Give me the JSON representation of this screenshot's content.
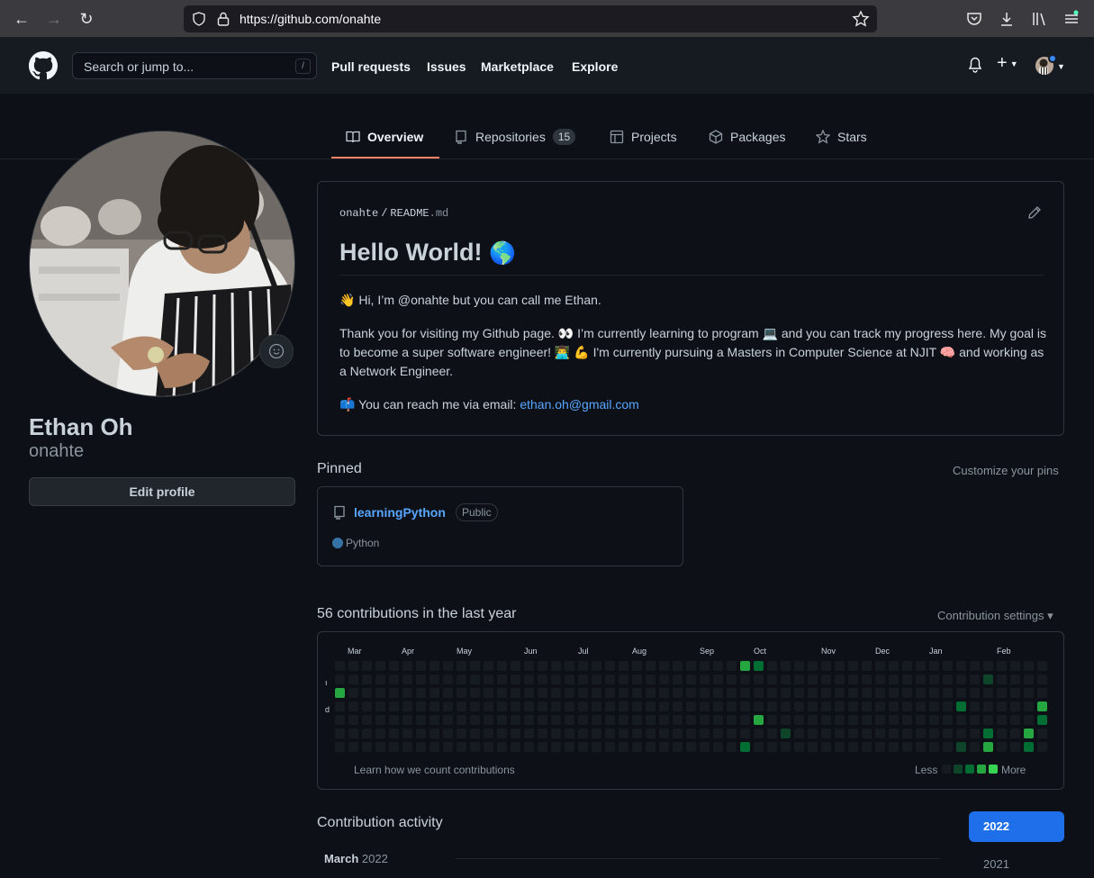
{
  "browser": {
    "url": "https://github.com/onahte"
  },
  "header": {
    "search_placeholder": "Search or jump to...",
    "search_key": "/",
    "nav": [
      "Pull requests",
      "Issues",
      "Marketplace",
      "Explore"
    ],
    "plus_label": "+"
  },
  "tabs": [
    {
      "label": "Overview",
      "icon": "book-icon",
      "active": true
    },
    {
      "label": "Repositories",
      "icon": "repo-icon",
      "count": "15"
    },
    {
      "label": "Projects",
      "icon": "table-icon"
    },
    {
      "label": "Packages",
      "icon": "package-icon"
    },
    {
      "label": "Stars",
      "icon": "star-icon"
    }
  ],
  "profile": {
    "full_name": "Ethan Oh",
    "username": "onahte",
    "edit_label": "Edit profile"
  },
  "readme": {
    "owner": "onahte",
    "sep": "/",
    "file": "README",
    "ext": ".md",
    "title": "Hello World!",
    "title_emoji": "🌎",
    "line1": "Hi, I’m @onahte but you can call me Ethan.",
    "line1_emoji": "👋",
    "para2_a": "Thank you for visiting my Github page. ",
    "para2_b": " I’m currently learning to program ",
    "para2_c": " and you can track my progress here. My goal is to become a super software engineer! ",
    "para2_d": " I'm currently pursuing a Masters in Computer Science at NJIT ",
    "para2_e": " and working as a Network Engineer.",
    "emoji_eyes": "👀",
    "emoji_laptop": "💻",
    "emoji_tech": "👨‍💻",
    "emoji_muscle": "💪",
    "emoji_brain": "🧠",
    "contact_emoji": "📫",
    "contact_text": "You can reach me via email: ",
    "email": "ethan.oh@gmail.com"
  },
  "pinned": {
    "title": "Pinned",
    "customize": "Customize your pins",
    "repo_name": "learningPython",
    "visibility": "Public",
    "language": "Python",
    "language_color": "#3572a5"
  },
  "contributions": {
    "title": "56 contributions in the last year",
    "settings": "Contribution settings ▾",
    "months": [
      "Mar",
      "Apr",
      "May",
      "Jun",
      "Jul",
      "Aug",
      "Sep",
      "Oct",
      "Nov",
      "Dec",
      "Jan",
      "Feb"
    ],
    "day_labels": [
      "ı",
      "d"
    ],
    "learn": "Learn how we count contributions",
    "less": "Less",
    "more": "More",
    "legend_colors": [
      "#161b22",
      "#0e4429",
      "#006d32",
      "#26a641",
      "#39d353"
    ],
    "active_cells": [
      {
        "week": 0,
        "day": 2,
        "level": 3
      },
      {
        "week": 30,
        "day": 0,
        "level": 3
      },
      {
        "week": 31,
        "day": 0,
        "level": 2
      },
      {
        "week": 31,
        "day": 4,
        "level": 3
      },
      {
        "week": 30,
        "day": 6,
        "level": 2
      },
      {
        "week": 33,
        "day": 5,
        "level": 1
      },
      {
        "week": 46,
        "day": 3,
        "level": 2
      },
      {
        "week": 46,
        "day": 6,
        "level": 1
      },
      {
        "week": 48,
        "day": 1,
        "level": 1
      },
      {
        "week": 48,
        "day": 5,
        "level": 2
      },
      {
        "week": 48,
        "day": 6,
        "level": 3
      },
      {
        "week": 51,
        "day": 5,
        "level": 3
      },
      {
        "week": 51,
        "day": 6,
        "level": 2
      },
      {
        "week": 52,
        "day": 3,
        "level": 3
      },
      {
        "week": 52,
        "day": 4,
        "level": 2
      }
    ]
  },
  "activity": {
    "title": "Contribution activity",
    "month": "March",
    "year": "2022",
    "years": [
      "2022",
      "2021"
    ]
  }
}
